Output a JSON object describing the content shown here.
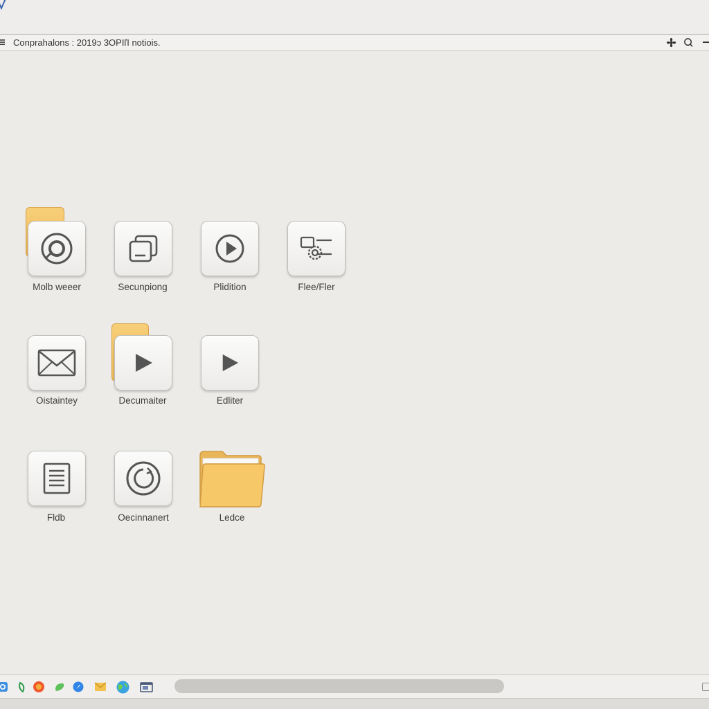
{
  "toolbar": {
    "title": "Conprahalons : 2019ↄ 3OPIľI notiois."
  },
  "icons": [
    {
      "label": "Molb weeer",
      "icon": "record-circle-icon"
    },
    {
      "label": "Secunpiong",
      "icon": "windows-stack-icon"
    },
    {
      "label": "Plidition",
      "icon": "play-circle-icon"
    },
    {
      "label": "Flee/Fler",
      "icon": "gear-settings-icon"
    },
    {
      "label": "Oistaintey",
      "icon": "mail-envelope-icon"
    },
    {
      "label": "Decumaiter",
      "icon": "play-triangle-icon"
    },
    {
      "label": "Edliter",
      "icon": "play-triangle-icon"
    },
    {
      "label": "Fldb",
      "icon": "document-lines-icon"
    },
    {
      "label": "Oecinnanert",
      "icon": "refresh-circle-icon"
    },
    {
      "label": "Ledce",
      "icon": "folder-icon"
    }
  ],
  "colors": {
    "accent_folder": "#f0bf62",
    "background": "#ecebe8"
  }
}
